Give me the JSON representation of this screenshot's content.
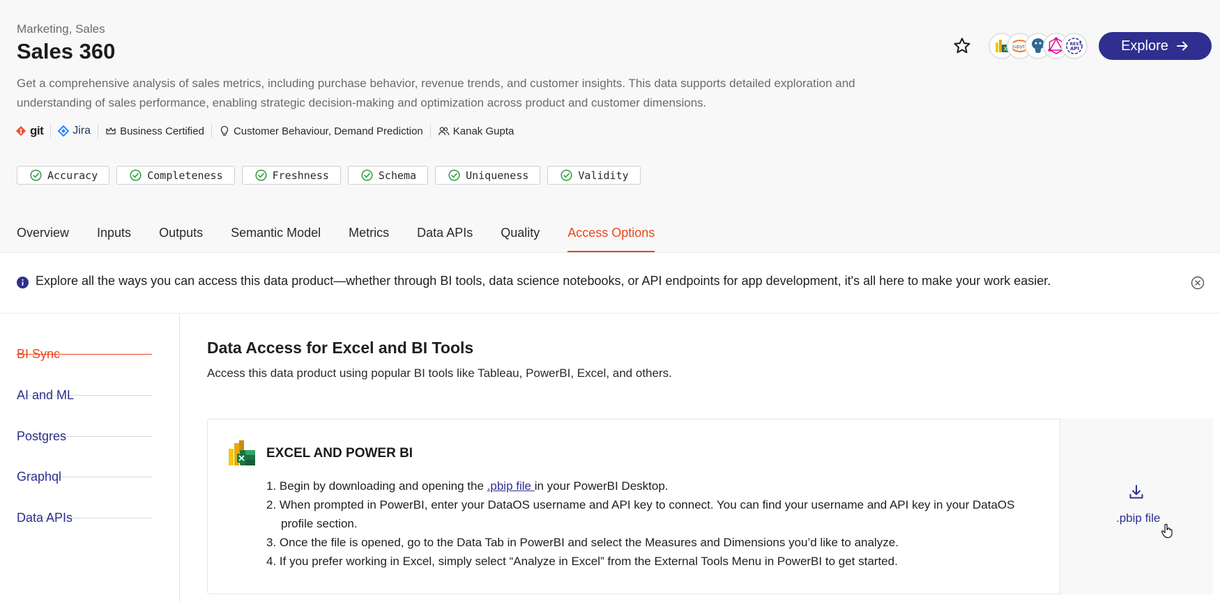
{
  "header": {
    "category": "Marketing, Sales",
    "title": "Sales 360",
    "description": "Get a comprehensive analysis of sales metrics, including purchase behavior, revenue trends, and customer insights. This data supports detailed exploration and understanding of sales performance, enabling strategic decision-making and optimization across product and customer dimensions.",
    "meta": {
      "git": "git",
      "jira": "Jira",
      "certification": "Business Certified",
      "use_cases": "Customer Behaviour, Demand Prediction",
      "owner": "Kanak Gupta"
    },
    "quality_checks": [
      "Accuracy",
      "Completeness",
      "Freshness",
      "Schema",
      "Uniqueness",
      "Validity"
    ],
    "explore_label": "Explore",
    "tool_icons": [
      "powerbi-excel",
      "jupyter",
      "postgres",
      "graphql",
      "rest-api"
    ],
    "jupyter_text": "jupyter",
    "rest_text": "REST",
    "api_text": "API"
  },
  "tabs": [
    "Overview",
    "Inputs",
    "Outputs",
    "Semantic Model",
    "Metrics",
    "Data APIs",
    "Quality",
    "Access Options"
  ],
  "active_tab": "Access Options",
  "banner": {
    "text": "Explore all the ways you can access this data product—whether through BI tools, data science notebooks, or API endpoints for app development, it's all here to make your work easier."
  },
  "sidebar": {
    "items": [
      "BI Sync",
      "AI and ML",
      "Postgres",
      "Graphql",
      "Data APIs"
    ],
    "active": "BI Sync"
  },
  "main": {
    "title": "Data Access for Excel and BI Tools",
    "subtitle": "Access this data product using popular BI tools like Tableau, PowerBI, Excel, and others.",
    "card": {
      "title": "EXCEL AND POWER BI",
      "step1_pre": "1. Begin by downloading and opening the ",
      "step1_link": ".pbip file ",
      "step1_post": "in your PowerBI Desktop.",
      "step2": "2. When prompted in PowerBI, enter your DataOS username and API key to connect. You can find your username and API key in your DataOS profile section.",
      "step3": "3. Once the file is opened, go to the Data Tab in PowerBI and select the Measures and Dimensions you’d like to analyze.",
      "step4": "4. If you prefer working in Excel, simply select “Analyze in Excel” from the External Tools Menu in PowerBI to get started.",
      "download_label": ".pbip file"
    }
  },
  "colors": {
    "accent": "#e9461c",
    "brand": "#2e2f8f",
    "check": "#2e9d3f"
  }
}
